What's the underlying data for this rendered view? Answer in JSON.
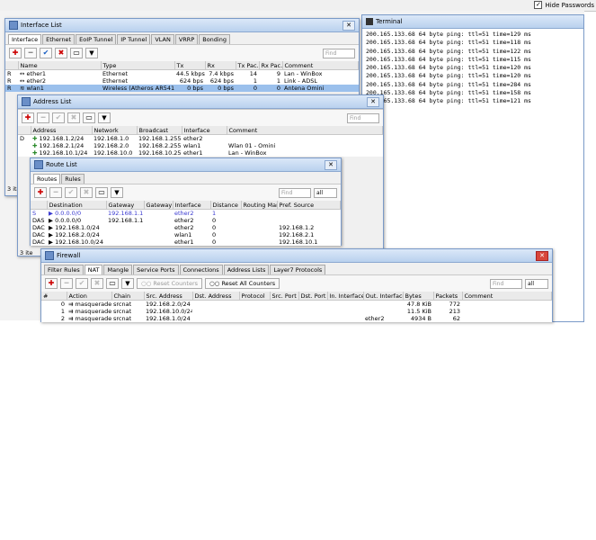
{
  "topbar": {
    "hide_passwords": "Hide Passwords",
    "checked": "✓"
  },
  "interface_list": {
    "title": "Interface List",
    "tabs": [
      "Interface",
      "Ethernet",
      "EoIP Tunnel",
      "IP Tunnel",
      "VLAN",
      "VRRP",
      "Bonding"
    ],
    "find": "Find",
    "columns": [
      "",
      "Name",
      "Type",
      "Tx",
      "Rx",
      "Tx Pac...",
      "Rx Pac...",
      "Comment"
    ],
    "rows": [
      [
        "R",
        "ether1",
        "Ethernet",
        "44.5 kbps",
        "7.4 kbps",
        "14",
        "9",
        "Lan - WinBox"
      ],
      [
        "R",
        "ether2",
        "Ethernet",
        "624 bps",
        "624 bps",
        "1",
        "1",
        "Link - ADSL"
      ],
      [
        "R",
        "wlan1",
        "Wireless (Atheros AR5413)",
        "0 bps",
        "0 bps",
        "0",
        "0",
        "Antena Omini"
      ]
    ]
  },
  "address_list": {
    "title": "Address List",
    "find": "Find",
    "columns": [
      "",
      "Address",
      "Network",
      "Broadcast",
      "Interface",
      "Comment"
    ],
    "rows": [
      [
        "D",
        "192.168.1.2/24",
        "192.168.1.0",
        "192.168.1.255",
        "ether2",
        ""
      ],
      [
        "",
        "192.168.2.1/24",
        "192.168.2.0",
        "192.168.2.255",
        "wlan1",
        "Wlan 01 - Omini"
      ],
      [
        "",
        "192.168.10.1/24",
        "192.168.10.0",
        "192.168.10.255",
        "ether1",
        "Lan - WinBox"
      ]
    ]
  },
  "route_list": {
    "title": "Route List",
    "tabs": [
      "Routes",
      "Rules"
    ],
    "find": "Find",
    "filter": "all",
    "columns": [
      "",
      "Destination",
      "Gateway",
      "Gateway ...",
      "Interface",
      "Distance",
      "Routing Mark",
      "Pref. Source"
    ],
    "rows": [
      [
        "S",
        "0.0.0.0/0",
        "192.168.1.1",
        "",
        "ether2",
        "1",
        "",
        ""
      ],
      [
        "DAS",
        "0.0.0.0/0",
        "192.168.1.1",
        "",
        "ether2",
        "0",
        "",
        ""
      ],
      [
        "DAC",
        "192.168.1.0/24",
        "",
        "",
        "ether2",
        "0",
        "",
        "192.168.1.2"
      ],
      [
        "DAC",
        "192.168.2.0/24",
        "",
        "",
        "wlan1",
        "0",
        "",
        "192.168.2.1"
      ],
      [
        "DAC",
        "192.168.10.0/24",
        "",
        "",
        "ether1",
        "0",
        "",
        "192.168.10.1"
      ]
    ]
  },
  "side_items": [
    "3 ite",
    "3 ite"
  ],
  "firewall": {
    "title": "Firewall",
    "tabs": [
      "Filter Rules",
      "NAT",
      "Mangle",
      "Service Ports",
      "Connections",
      "Address Lists",
      "Layer7 Protocols"
    ],
    "reset_counters": "Reset Counters",
    "reset_all_counters": "Reset All Counters",
    "find": "Find",
    "filter": "all",
    "columns": [
      "#",
      "Action",
      "Chain",
      "Src. Address",
      "Dst. Address",
      "Protocol",
      "Src. Port",
      "Dst. Port",
      "In. Interface",
      "Out. Interface",
      "Bytes",
      "Packets",
      "Comment"
    ],
    "rows": [
      [
        "0",
        "masquerade",
        "srcnat",
        "192.168.2.0/24",
        "",
        "",
        "",
        "",
        "",
        "",
        "47.8 KiB",
        "772",
        ""
      ],
      [
        "1",
        "masquerade",
        "srcnat",
        "192.168.10.0/24",
        "",
        "",
        "",
        "",
        "",
        "",
        "11.5 KiB",
        "213",
        ""
      ],
      [
        "2",
        "masquerade",
        "srcnat",
        "192.168.1.0/24",
        "",
        "",
        "",
        "",
        "",
        "ether2",
        "4934 B",
        "62",
        ""
      ]
    ]
  },
  "terminal": {
    "title": "Terminal",
    "lines": [
      "200.165.133.68 64 byte ping: ttl=51 time=129 ms",
      "200.165.133.68 64 byte ping: ttl=51 time=118 ms",
      "200.165.133.68 64 byte ping: ttl=51 time=122 ms",
      "200.165.133.68 64 byte ping: ttl=51 time=115 ms",
      "200.165.133.68 64 byte ping: ttl=51 time=120 ms",
      "200.165.133.68 64 byte ping: ttl=51 time=120 ms",
      "200.165.133.68 64 byte ping: ttl=51 time=284 ms",
      "200.165.133.68 64 byte ping: ttl=51 time=158 ms",
      "200.165.133.68 64 byte ping: ttl=51 time=121 ms"
    ]
  },
  "colors": {
    "title_bar": "#b9d1ee",
    "selected_row": "#9bc0ec",
    "static_route": "#3a3ad0",
    "close_red": "#d8473c"
  }
}
